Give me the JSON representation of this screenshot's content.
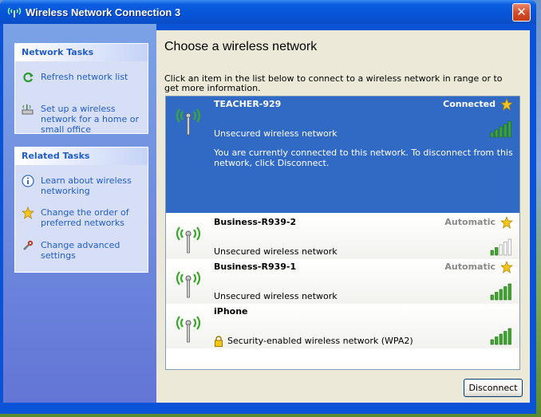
{
  "window": {
    "title": "Wireless Network Connection 3",
    "close_glyph": "✕"
  },
  "network_tasks": {
    "header": "Network Tasks",
    "items": [
      {
        "label": "Refresh network list",
        "icon": "refresh-icon"
      },
      {
        "label": "Set up a wireless network for a home or small office",
        "icon": "setup-wireless-icon"
      }
    ]
  },
  "related_tasks": {
    "header": "Related Tasks",
    "items": [
      {
        "label": "Learn about wireless networking",
        "icon": "info-icon"
      },
      {
        "label": "Change the order of preferred networks",
        "icon": "star-icon"
      },
      {
        "label": "Change advanced settings",
        "icon": "settings-icon"
      }
    ]
  },
  "main": {
    "heading": "Choose a wireless network",
    "instruction": "Click an item in the list below to connect to a wireless network in range or to get more information."
  },
  "networks": [
    {
      "name": "TEACHER-929",
      "status": "Connected",
      "security": "Unsecured wireless network",
      "message": "You are currently connected to this network. To disconnect from this network, click Disconnect.",
      "signal_bars": 5,
      "selected": true
    },
    {
      "name": "Business-R939-2",
      "status": "Automatic",
      "security": "Unsecured wireless network",
      "signal_bars": 2
    },
    {
      "name": "Business-R939-1",
      "status": "Automatic",
      "security": "Unsecured wireless network",
      "signal_bars": 5
    },
    {
      "name": "iPhone",
      "status": "",
      "security": "Security-enabled wireless network (WPA2)",
      "signal_bars": 5
    }
  ],
  "buttons": {
    "disconnect": "Disconnect"
  },
  "colors": {
    "accent": "#0a53d6",
    "selection": "#316ac5",
    "link": "#215dc6",
    "signal_on": "#3aa82a"
  }
}
